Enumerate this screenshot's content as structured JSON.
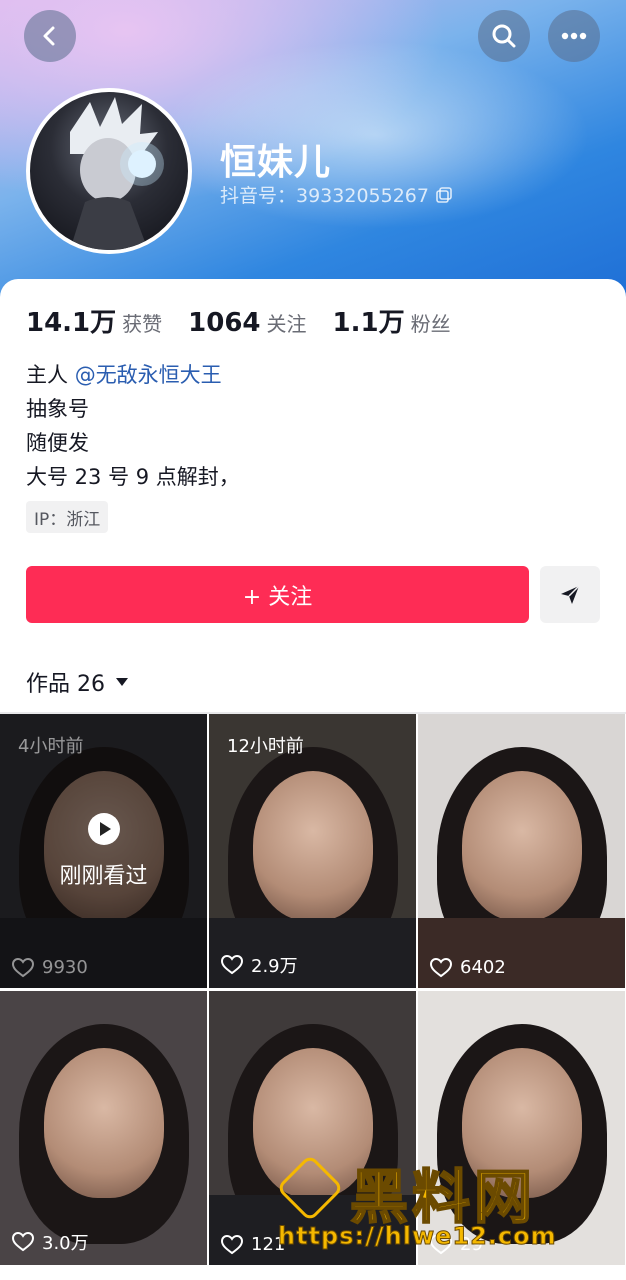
{
  "profile": {
    "name": "恒妹儿",
    "douyin_id": "抖音号：39332055267"
  },
  "stats": [
    {
      "num": "14.1万",
      "label": "获赞"
    },
    {
      "num": "1064",
      "label": "关注"
    },
    {
      "num": "1.1万",
      "label": "粉丝"
    }
  ],
  "bio": {
    "line1_prefix": "主人",
    "line1_mention": "@无敌永恒大王",
    "line2": "抽象号",
    "line3": "随便发",
    "line4": "大号 23 号 9 点解封，"
  },
  "ip_tag": "IP：浙江",
  "follow_button": "+ 关注",
  "works": {
    "title": "作品 26"
  },
  "videos": [
    {
      "time": "4小时前",
      "likes": "9930",
      "watched": "刚刚看过"
    },
    {
      "time": "12小时前",
      "likes": "2.9万"
    },
    {
      "time": "",
      "likes": "6402"
    },
    {
      "time": "",
      "likes": "3.0万"
    },
    {
      "time": "",
      "likes": "121"
    },
    {
      "time": "",
      "likes": "29"
    }
  ],
  "watermark": {
    "main": "黑料网",
    "url": "https://hlwe12.com"
  },
  "colors": {
    "accent": "#fe2c55",
    "mention": "#2a5db0",
    "watermark": "#f5b800"
  }
}
